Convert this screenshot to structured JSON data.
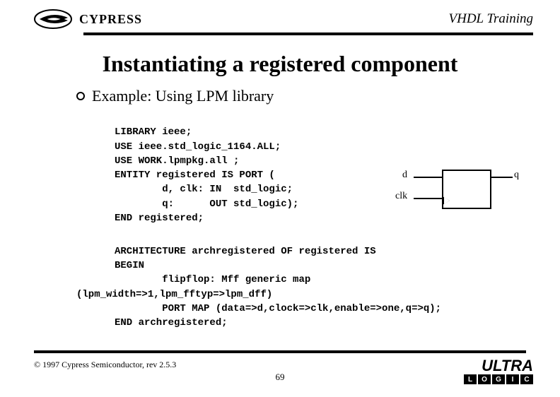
{
  "header": {
    "brand": "CYPRESS",
    "course": "VHDL Training"
  },
  "title": "Instantiating a registered component",
  "bullet": "Example: Using LPM library",
  "code": {
    "l1": "LIBRARY ieee;",
    "l2": "USE ieee.std_logic_1164.ALL;",
    "l3": "USE WORK.lpmpkg.all ;",
    "l4": "ENTITY registered IS PORT (",
    "l5": "        d, clk: IN  std_logic;",
    "l6": "        q:      OUT std_logic);",
    "l7": "END registered;",
    "a1": "ARCHITECTURE archregistered OF registered IS",
    "a2": "BEGIN",
    "a3_pre": "        flipflop: Mff generic map",
    "a3_map": "(lpm_width=>1,lpm_fftyp=>lpm_dff)",
    "a4": "        PORT MAP (data=>d,clock=>clk,enable=>one,q=>q);",
    "a5": "END archregistered;"
  },
  "diagram": {
    "d": "d",
    "clk": "clk",
    "q": "q"
  },
  "footer": {
    "copyright": "© 1997 Cypress Semiconductor, rev 2.5.3",
    "page": "69",
    "ultra": "ULTRA",
    "logic": [
      "L",
      "O",
      "G",
      "I",
      "C"
    ]
  }
}
